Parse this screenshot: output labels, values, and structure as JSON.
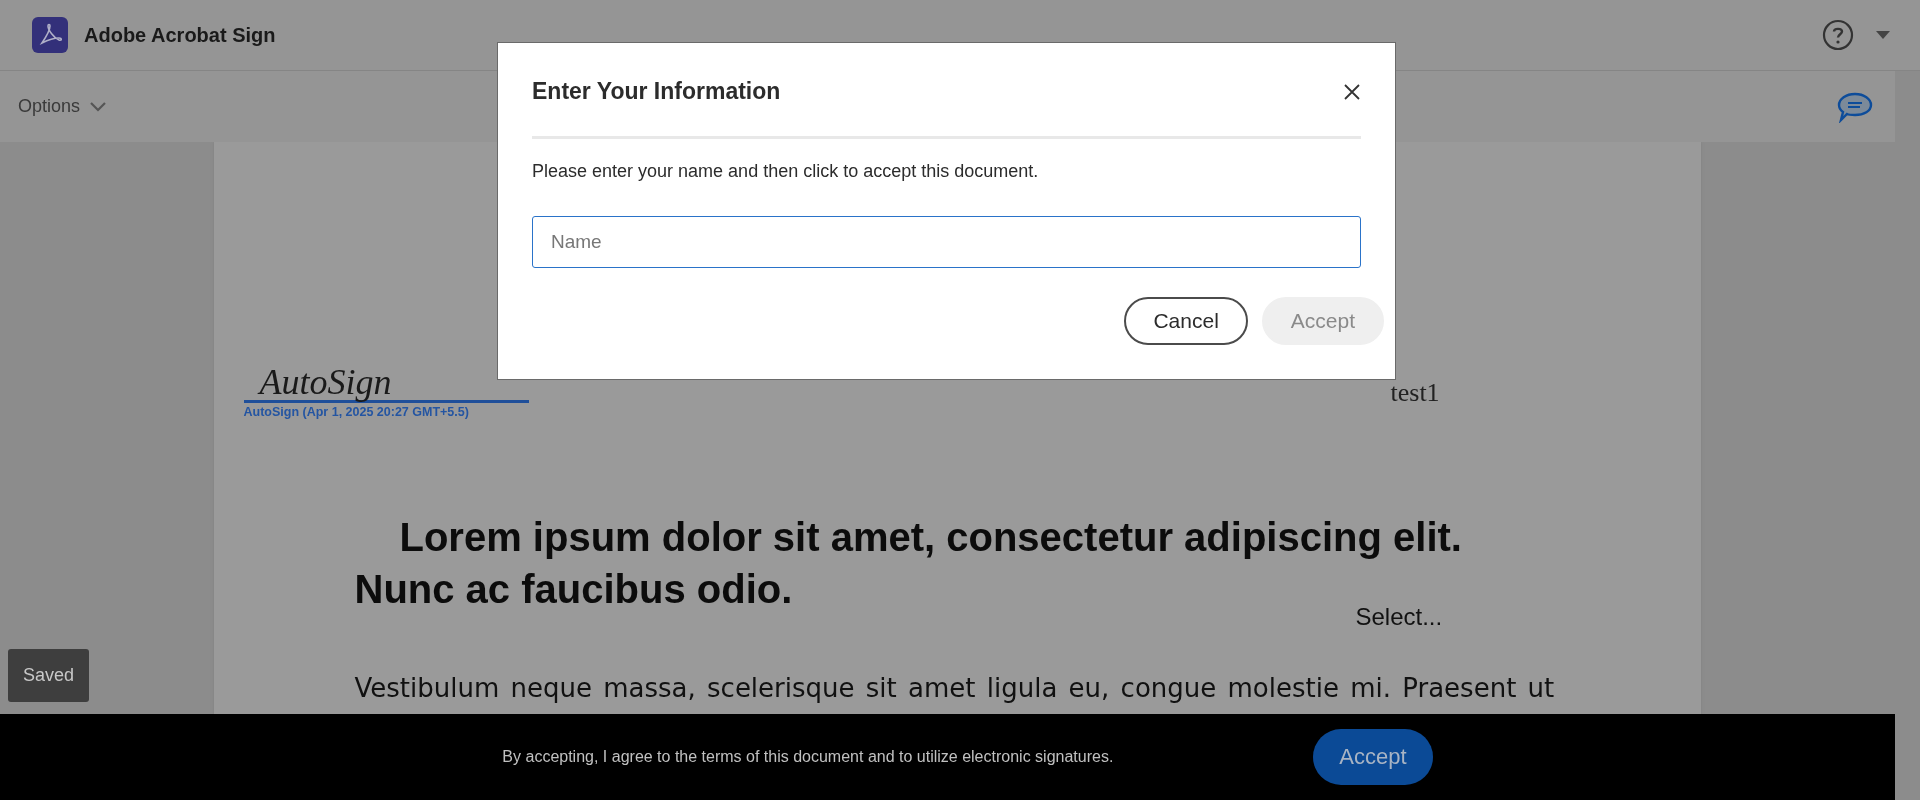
{
  "app": {
    "title": "Adobe Acrobat Sign"
  },
  "toolbar": {
    "options_label": "Options"
  },
  "document": {
    "signature": {
      "script": "AutoSign",
      "caption": "AutoSign (Apr 1, 2025 20:27 GMT+5.5)"
    },
    "field_value": "test1",
    "heading": "Lorem ipsum dolor sit amet, consectetur adipiscing elit. Nunc ac faucibus odio.",
    "dropdown": "Select...",
    "paragraph": "Vestibulum neque massa, scelerisque sit amet ligula eu, congue molestie mi. Praesent ut"
  },
  "saved_badge": "Saved",
  "dialog": {
    "title": "Enter Your Information",
    "message": "Please enter your name and then click to accept this document.",
    "name_field": {
      "placeholder": "Name"
    },
    "buttons": [
      {
        "label": "Cancel",
        "disabled": false
      },
      {
        "label": "Accept",
        "disabled": true
      }
    ]
  },
  "footer": {
    "text": "By accepting, I agree to the terms of this document and to utilize electronic signatures.",
    "button": "Accept"
  }
}
